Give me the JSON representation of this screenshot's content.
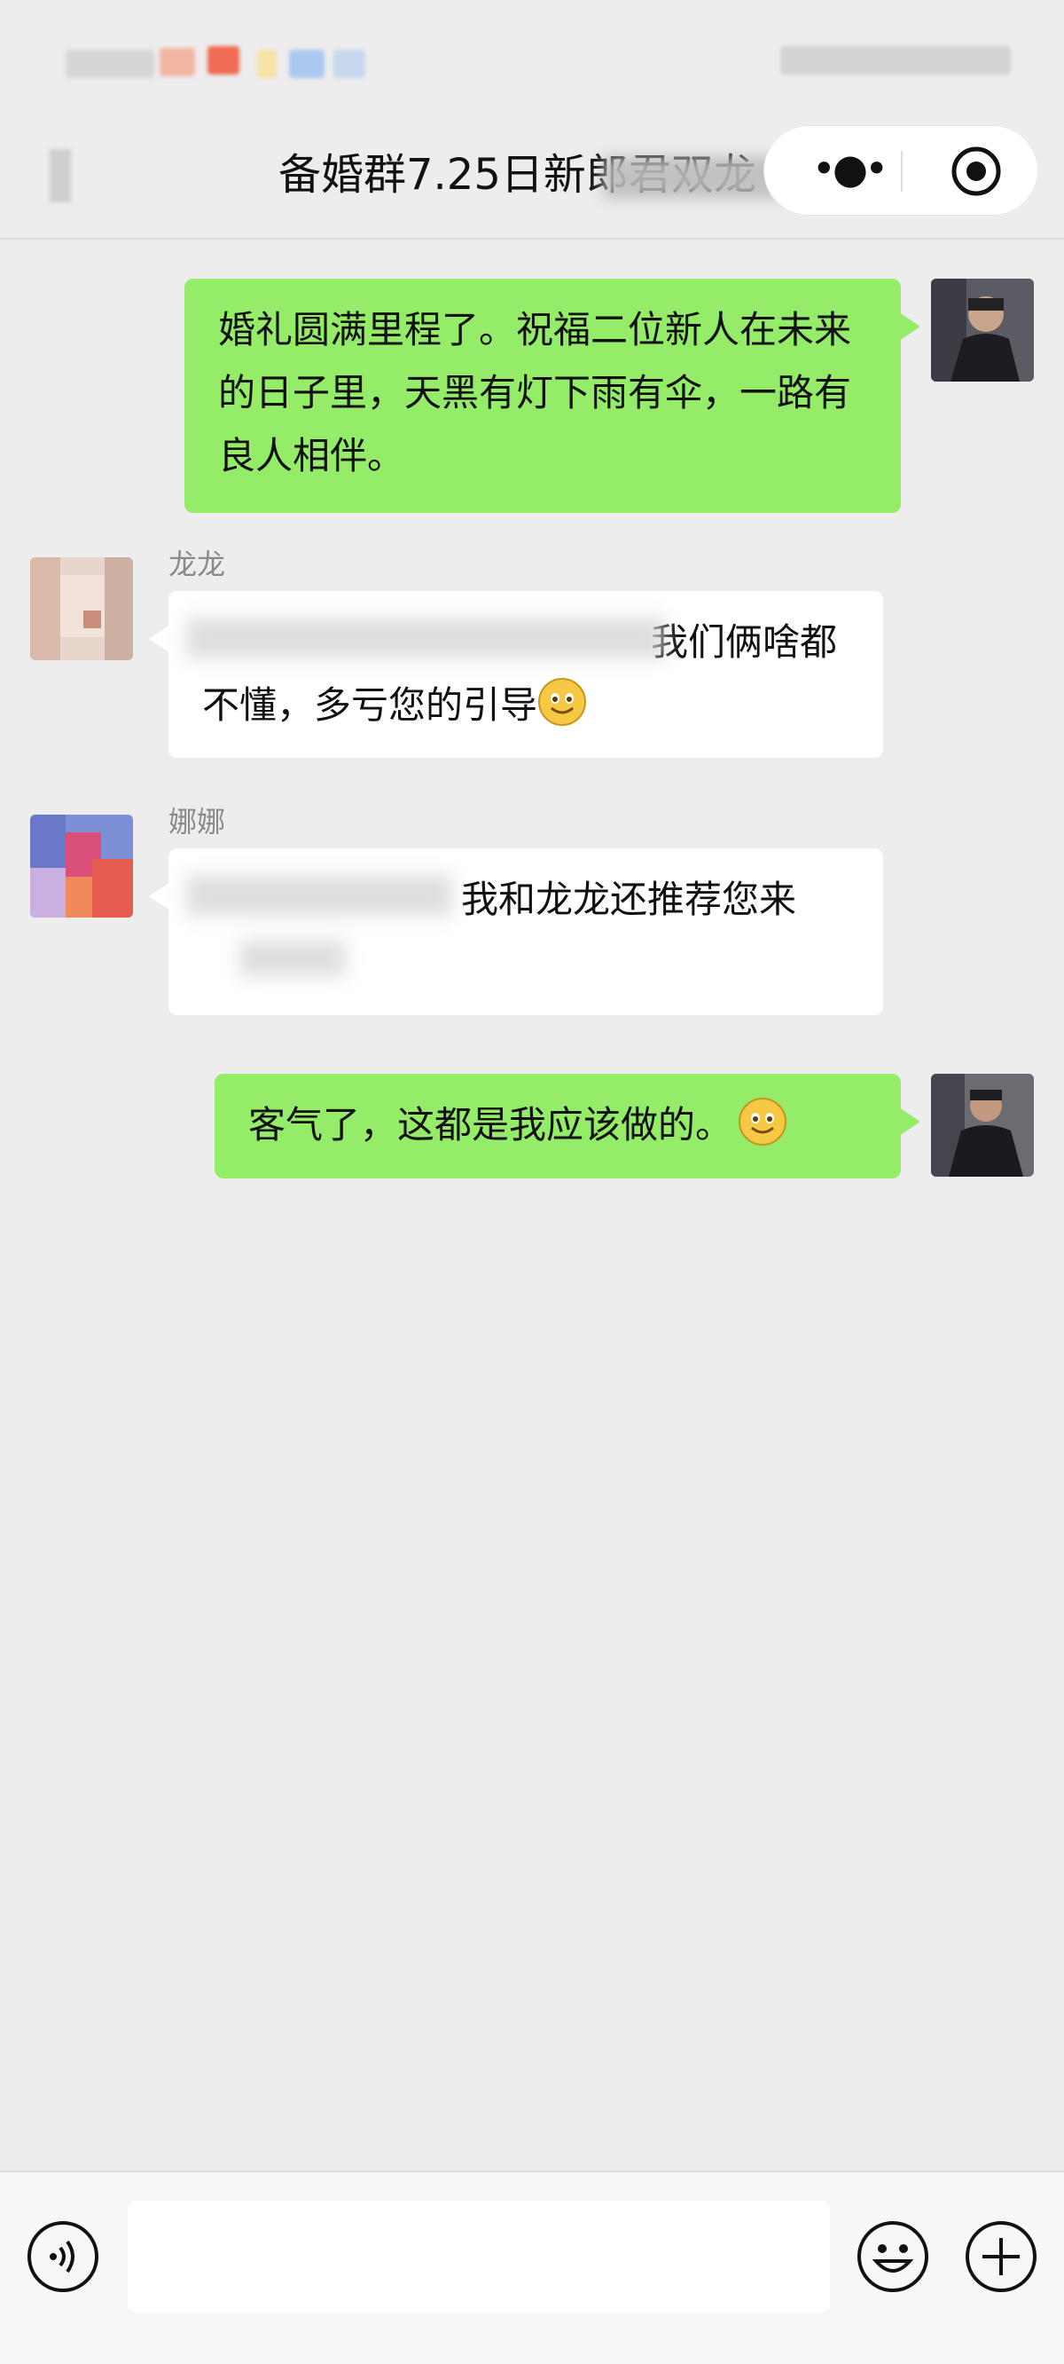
{
  "header": {
    "title": "备婚群7.25日新郎君双龙"
  },
  "messages": [
    {
      "side": "right",
      "text": "婚礼圆满里程了。祝福二位新人在未来的日子里，天黑有灯下雨有伞，一路有良人相伴。"
    },
    {
      "side": "left",
      "sender": "龙龙",
      "text_visible": "我们俩啥都不懂，多亏您的引导"
    },
    {
      "side": "left",
      "sender": "娜娜",
      "text_visible": "我和龙龙还推荐您来"
    },
    {
      "side": "right",
      "text": "客气了，这都是我应该做的。"
    }
  ],
  "colors": {
    "bg": "#ededed",
    "bubble_green": "#95ec69",
    "bubble_white": "#ffffff",
    "sender_name": "#8a8a8a"
  },
  "icons": [
    "back-icon",
    "more-icon",
    "target-icon",
    "voice-icon",
    "emoji-icon",
    "add-icon",
    "smile-emoji"
  ]
}
